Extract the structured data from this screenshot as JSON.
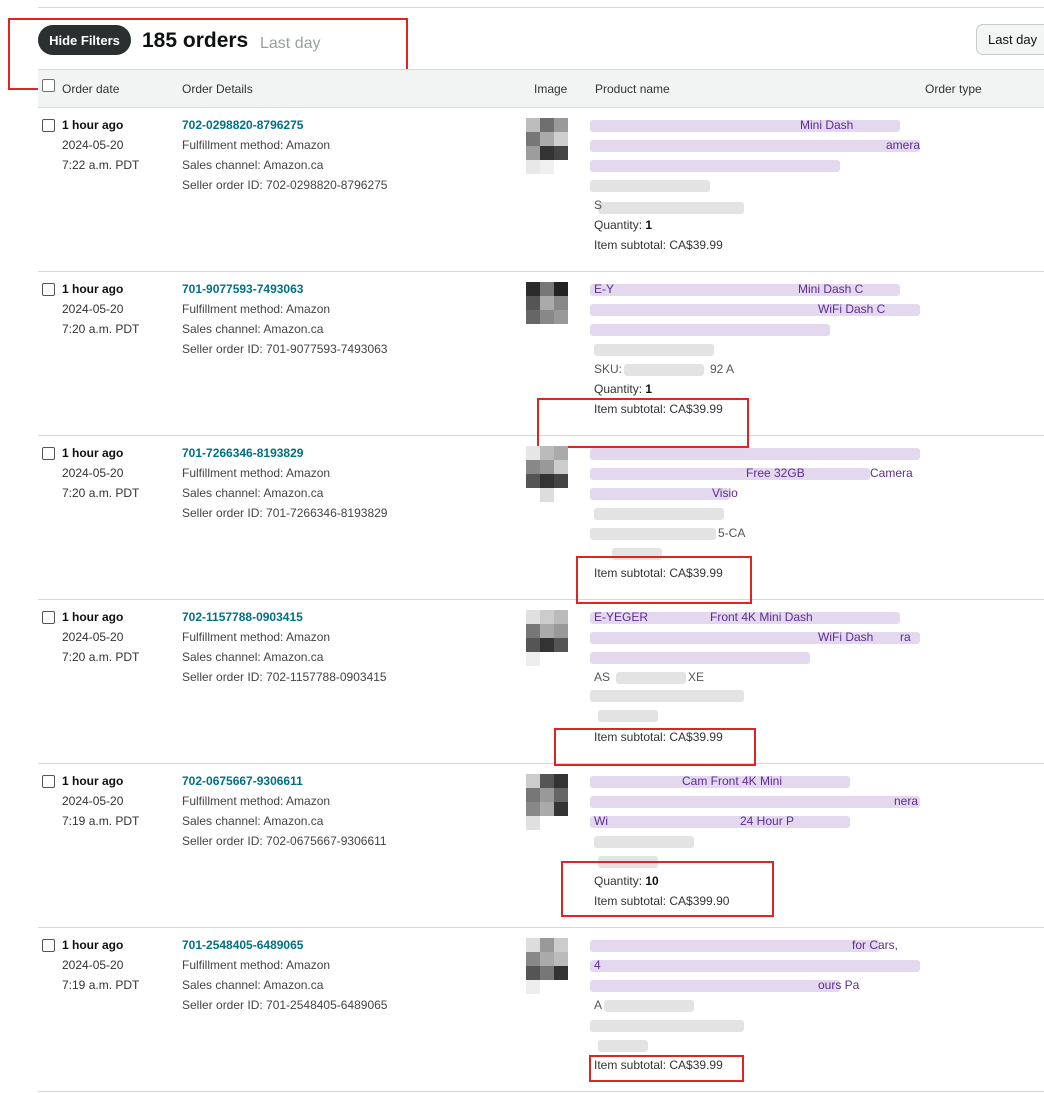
{
  "toolbar": {
    "hide_filters_label": "Hide Filters",
    "orders_count": "185 orders",
    "period_label": "Last day",
    "period_button_label": "Last day"
  },
  "columns": {
    "order_date": "Order date",
    "order_details": "Order Details",
    "image": "Image",
    "product_name": "Product name",
    "order_type": "Order type"
  },
  "orders": [
    {
      "relative_time": "1 hour ago",
      "date": "2024-05-20",
      "time": "7:22 a.m. PDT",
      "order_id": "702-0298820-8796275",
      "fulfillment": "Fulfillment method: Amazon",
      "channel": "Sales channel: Amazon.ca",
      "seller_order_id": "Seller order ID: 702-0298820-8796275",
      "quantity_label": "Quantity:",
      "quantity": "1",
      "subtotal": "Item subtotal: CA$39.99",
      "fragments": [
        "Mini Dash",
        "amera",
        "S"
      ]
    },
    {
      "relative_time": "1 hour ago",
      "date": "2024-05-20",
      "time": "7:20 a.m. PDT",
      "order_id": "701-9077593-7493063",
      "fulfillment": "Fulfillment method: Amazon",
      "channel": "Sales channel: Amazon.ca",
      "seller_order_id": "Seller order ID: 701-9077593-7493063",
      "quantity_label": "Quantity:",
      "quantity": "1",
      "subtotal": "Item subtotal: CA$39.99",
      "fragments": [
        "E-Y",
        "Mini Dash C",
        "WiFi Dash C",
        "SKU: ",
        "92    A"
      ]
    },
    {
      "relative_time": "1 hour ago",
      "date": "2024-05-20",
      "time": "7:20 a.m. PDT",
      "order_id": "701-7266346-8193829",
      "fulfillment": "Fulfillment method: Amazon",
      "channel": "Sales channel: Amazon.ca",
      "seller_order_id": "Seller order ID: 701-7266346-8193829",
      "subtotal": "Item subtotal: CA$39.99",
      "fragments": [
        "Free 32GB",
        "Camera",
        "Visio",
        "5-CA"
      ]
    },
    {
      "relative_time": "1 hour ago",
      "date": "2024-05-20",
      "time": "7:20 a.m. PDT",
      "order_id": "702-1157788-0903415",
      "fulfillment": "Fulfillment method: Amazon",
      "channel": "Sales channel: Amazon.ca",
      "seller_order_id": "Seller order ID: 702-1157788-0903415",
      "subtotal": "Item subtotal: CA$39.99",
      "fragments": [
        "E-YEGER",
        "Front 4K Mini Dash",
        "WiFi Dash",
        "ra",
        "AS",
        "XE"
      ]
    },
    {
      "relative_time": "1 hour ago",
      "date": "2024-05-20",
      "time": "7:19 a.m. PDT",
      "order_id": "702-0675667-9306611",
      "fulfillment": "Fulfillment method: Amazon",
      "channel": "Sales channel: Amazon.ca",
      "seller_order_id": "Seller order ID: 702-0675667-9306611",
      "quantity_label": "Quantity:",
      "quantity": "10",
      "subtotal": "Item subtotal: CA$399.90",
      "fragments": [
        "Cam Front 4K Mini",
        "nera",
        "Wi",
        "24 Hour P"
      ]
    },
    {
      "relative_time": "1 hour ago",
      "date": "2024-05-20",
      "time": "7:19 a.m. PDT",
      "order_id": "701-2548405-6489065",
      "fulfillment": "Fulfillment method: Amazon",
      "channel": "Sales channel: Amazon.ca",
      "seller_order_id": "Seller order ID: 701-2548405-6489065",
      "subtotal": "Item subtotal: CA$39.99",
      "fragments": [
        "for Cars,",
        "4",
        "ours Pa",
        "A"
      ]
    }
  ],
  "colors": {
    "link_teal": "#007185",
    "product_purple": "#5d2d91",
    "annotation_red": "#e02424",
    "button_dark": "#2a2f2f"
  }
}
